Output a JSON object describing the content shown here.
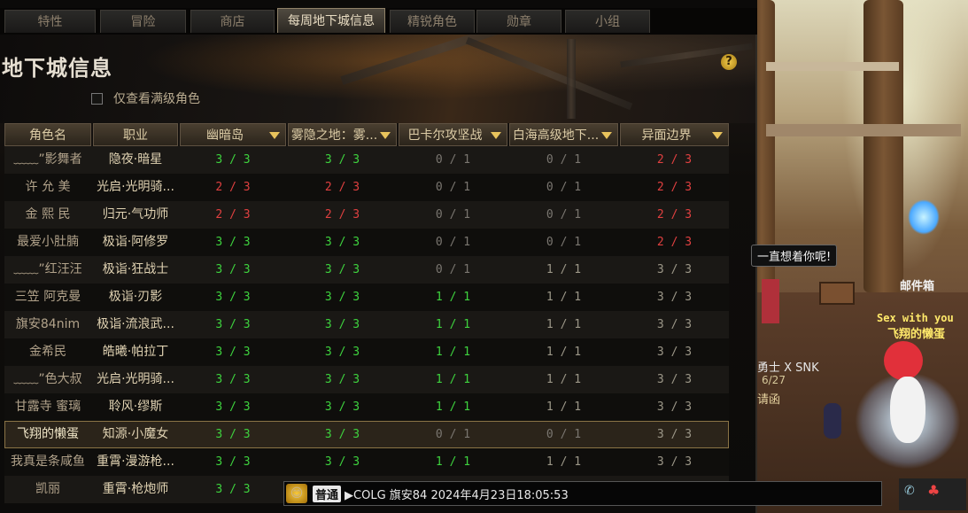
{
  "tabs": [
    "特性",
    "冒险",
    "商店",
    "每周地下城信息",
    "精锐角色",
    "勋章",
    "小组"
  ],
  "active_tab": 3,
  "title": "地下城信息",
  "help": "?",
  "filter_label": "仅查看满级角色",
  "columns": [
    "角色名",
    "职业",
    "幽暗岛",
    "雾隐之地：雾...",
    "巴卡尔攻坚战",
    "白海高级地下...",
    "异面边界"
  ],
  "rows": [
    {
      "name": "﹏﹏”影舞者",
      "job": "隐夜·暗星",
      "v": [
        "3 / 3",
        "3 / 3",
        "0 / 1",
        "0 / 1",
        "2 / 3"
      ],
      "c": [
        "g",
        "g",
        "z",
        "z",
        "r"
      ]
    },
    {
      "name": "许 允 美",
      "job": "光启·光明骑...",
      "v": [
        "2 / 3",
        "2 / 3",
        "0 / 1",
        "0 / 1",
        "2 / 3"
      ],
      "c": [
        "r",
        "r",
        "z",
        "z",
        "r"
      ]
    },
    {
      "name": "金 熙 民",
      "job": "归元·气功师",
      "v": [
        "2 / 3",
        "2 / 3",
        "0 / 1",
        "0 / 1",
        "2 / 3"
      ],
      "c": [
        "r",
        "r",
        "z",
        "z",
        "r"
      ]
    },
    {
      "name": "最爱小肚腩",
      "job": "极诣·阿修罗",
      "v": [
        "3 / 3",
        "3 / 3",
        "0 / 1",
        "0 / 1",
        "2 / 3"
      ],
      "c": [
        "g",
        "g",
        "z",
        "z",
        "r"
      ]
    },
    {
      "name": "﹏﹏”红汪汪",
      "job": "极诣·狂战士",
      "v": [
        "3 / 3",
        "3 / 3",
        "0 / 1",
        "1 / 1",
        "3 / 3"
      ],
      "c": [
        "g",
        "g",
        "z",
        "y",
        "y"
      ]
    },
    {
      "name": "三笠 阿克曼",
      "job": "极诣·刃影",
      "v": [
        "3 / 3",
        "3 / 3",
        "1 / 1",
        "1 / 1",
        "3 / 3"
      ],
      "c": [
        "g",
        "g",
        "g",
        "y",
        "y"
      ]
    },
    {
      "name": "旗安84nim",
      "job": "极诣·流浪武...",
      "v": [
        "3 / 3",
        "3 / 3",
        "1 / 1",
        "1 / 1",
        "3 / 3"
      ],
      "c": [
        "g",
        "g",
        "g",
        "y",
        "y"
      ]
    },
    {
      "name": "金希民",
      "job": "皓曦·帕拉丁",
      "v": [
        "3 / 3",
        "3 / 3",
        "1 / 1",
        "1 / 1",
        "3 / 3"
      ],
      "c": [
        "g",
        "g",
        "g",
        "y",
        "y"
      ]
    },
    {
      "name": "﹏﹏”色大叔",
      "job": "光启·光明骑...",
      "v": [
        "3 / 3",
        "3 / 3",
        "1 / 1",
        "1 / 1",
        "3 / 3"
      ],
      "c": [
        "g",
        "g",
        "g",
        "y",
        "y"
      ]
    },
    {
      "name": "甘露寺 蜜璃",
      "job": "聆风·缪斯",
      "v": [
        "3 / 3",
        "3 / 3",
        "1 / 1",
        "1 / 1",
        "3 / 3"
      ],
      "c": [
        "g",
        "g",
        "g",
        "y",
        "y"
      ]
    },
    {
      "name": "飞翔的懒蛋",
      "job": "知源·小魔女",
      "v": [
        "3 / 3",
        "3 / 3",
        "0 / 1",
        "0 / 1",
        "3 / 3"
      ],
      "c": [
        "g",
        "g",
        "z",
        "z",
        "y"
      ],
      "selected": true
    },
    {
      "name": "我真是条咸鱼",
      "job": "重霄·漫游枪...",
      "v": [
        "3 / 3",
        "3 / 3",
        "1 / 1",
        "1 / 1",
        "3 / 3"
      ],
      "c": [
        "g",
        "g",
        "g",
        "y",
        "y"
      ]
    },
    {
      "name": "凯丽",
      "job": "重霄·枪炮师",
      "v": [
        "3 / 3",
        "",
        "",
        "",
        ""
      ],
      "c": [
        "g",
        "",
        "",
        "",
        ""
      ]
    }
  ],
  "scene": {
    "bubble": "一直想着你呢!",
    "mailbox": "邮件箱",
    "tagline": "Sex with you",
    "player": "飞翔的懒蛋",
    "other": "勇士 X SNK",
    "other2": "6/27",
    "other3": "请函"
  },
  "chat": {
    "icon": "😊",
    "mode": "普通",
    "text": "▶COLG 旗安84 2024年4月23日18:05:53"
  }
}
